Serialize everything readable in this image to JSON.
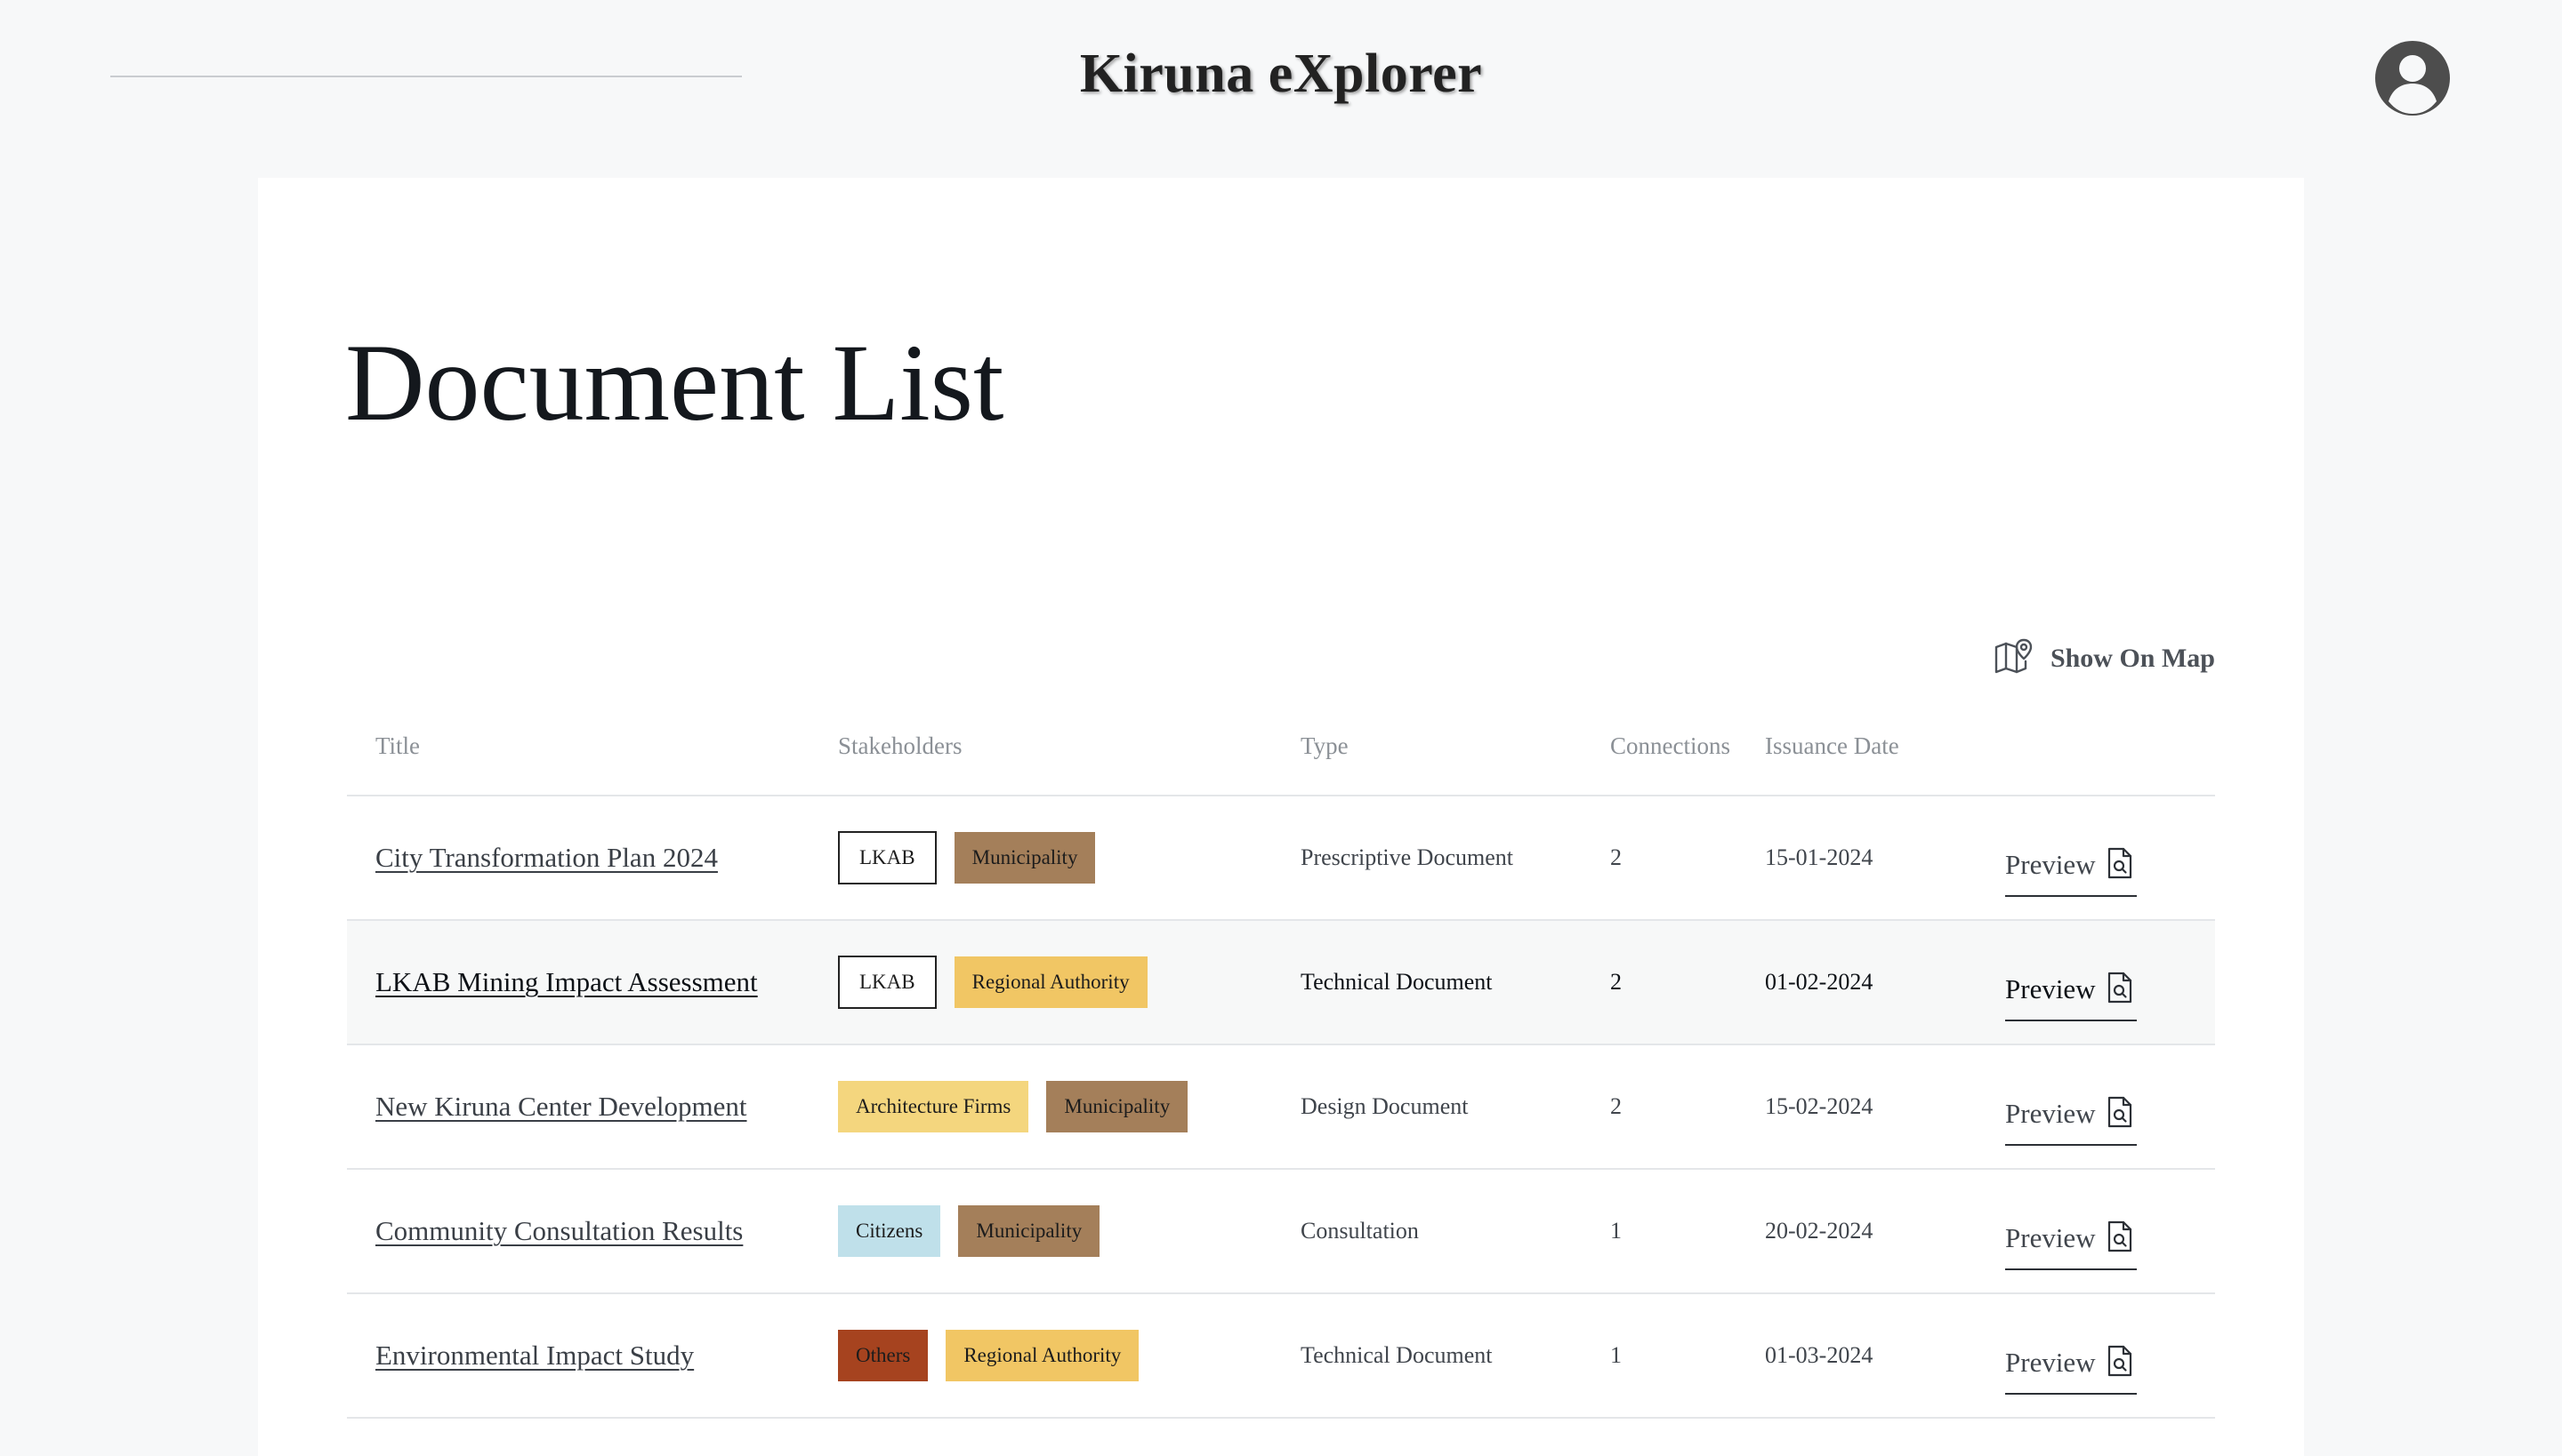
{
  "header": {
    "app_title": "Kiruna eXplorer",
    "user_icon": "user-circle-icon"
  },
  "page": {
    "title": "Document List"
  },
  "toolbar": {
    "show_on_map_label": "Show On Map",
    "show_on_map_icon": "map-pin-icon"
  },
  "table": {
    "headers": {
      "title": "Title",
      "stakeholders": "Stakeholders",
      "type": "Type",
      "connections": "Connections",
      "issuance_date": "Issuance Date"
    },
    "preview_label": "Preview",
    "preview_icon": "document-search-icon",
    "rows": [
      {
        "title": "City Transformation Plan 2024",
        "stakeholders": [
          {
            "label": "LKAB",
            "color": "#ffffff"
          },
          {
            "label": "Municipality",
            "color": "#a47f5a"
          }
        ],
        "type": "Prescriptive Document",
        "connections": "2",
        "issuance_date": "15-01-2024"
      },
      {
        "title": "LKAB Mining Impact Assessment",
        "stakeholders": [
          {
            "label": "LKAB",
            "color": "#ffffff"
          },
          {
            "label": "Regional Authority",
            "color": "#f1c664"
          }
        ],
        "type": "Technical Document",
        "connections": "2",
        "issuance_date": "01-02-2024"
      },
      {
        "title": "New Kiruna Center Development",
        "stakeholders": [
          {
            "label": "Architecture Firms",
            "color": "#f4d67e"
          },
          {
            "label": "Municipality",
            "color": "#a47f5a"
          }
        ],
        "type": "Design Document",
        "connections": "2",
        "issuance_date": "15-02-2024"
      },
      {
        "title": "Community Consultation Results",
        "stakeholders": [
          {
            "label": "Citizens",
            "color": "#bfe0ea"
          },
          {
            "label": "Municipality",
            "color": "#a47f5a"
          }
        ],
        "type": "Consultation",
        "connections": "1",
        "issuance_date": "20-02-2024"
      },
      {
        "title": "Environmental Impact Study",
        "stakeholders": [
          {
            "label": "Others",
            "color": "#a6431f"
          },
          {
            "label": "Regional Authority",
            "color": "#f1c664"
          }
        ],
        "type": "Technical Document",
        "connections": "1",
        "issuance_date": "01-03-2024"
      }
    ]
  }
}
